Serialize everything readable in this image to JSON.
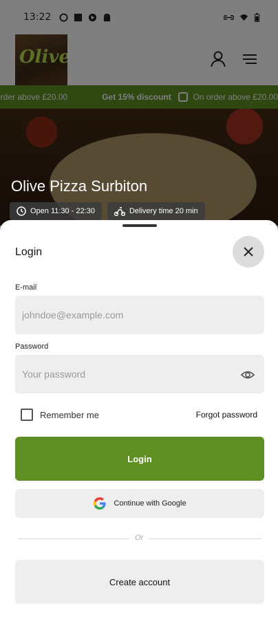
{
  "status_bar": {
    "time": "13:22"
  },
  "promo_banner": {
    "left_text": "order above £20.00",
    "discount_text": "Get 15% discount",
    "right_text": "On order above £20.00"
  },
  "restaurant": {
    "name": "Olive Pizza Surbiton",
    "logo_text": "Olive",
    "open_hours": "Open 11:30 - 22:30",
    "delivery_time": "Delivery time 20 min"
  },
  "login_sheet": {
    "title": "Login",
    "email_label": "E-mail",
    "email_placeholder": "johndoe@example.com",
    "password_label": "Password",
    "password_placeholder": "Your password",
    "remember_label": "Remember me",
    "forgot_label": "Forgot password",
    "login_button": "Login",
    "google_button": "Continue with Google",
    "divider_text": "Or",
    "create_account_button": "Create account"
  },
  "colors": {
    "brand_green": "#5f8f22",
    "field_bg": "#eeeeee"
  },
  "icons": {
    "status_left": [
      "circle-icon",
      "square-icon",
      "media-icon",
      "android-icon"
    ],
    "status_right": [
      "link-icon",
      "wifi-icon",
      "battery-icon"
    ],
    "header": [
      "user-icon",
      "menu-icon"
    ],
    "sheet": [
      "close-icon",
      "eye-icon",
      "google-icon"
    ]
  }
}
